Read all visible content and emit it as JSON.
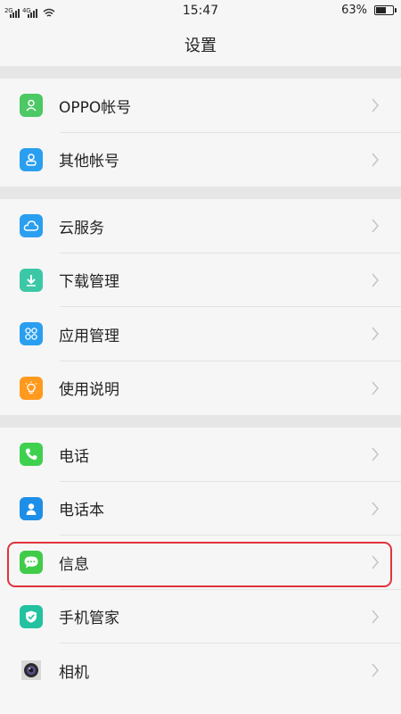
{
  "status_bar": {
    "sim1_network": "2G",
    "sim2_network": "4G",
    "time": "15:47",
    "battery_percent": "63%",
    "battery_level": 0.63
  },
  "header": {
    "title": "设置"
  },
  "sections": [
    {
      "items": [
        {
          "label": "OPPO帐号",
          "icon": "account-icon",
          "color": "#4cc864"
        },
        {
          "label": "其他帐号",
          "icon": "user-icon",
          "color": "#2a9ff0"
        }
      ]
    },
    {
      "items": [
        {
          "label": "云服务",
          "icon": "cloud-icon",
          "color": "#2a9ff0"
        },
        {
          "label": "下载管理",
          "icon": "download-icon",
          "color": "#3cc8a6"
        },
        {
          "label": "应用管理",
          "icon": "apps-icon",
          "color": "#2a9ff0"
        },
        {
          "label": "使用说明",
          "icon": "bulb-icon",
          "color": "#ff9a1f"
        }
      ]
    },
    {
      "items": [
        {
          "label": "电话",
          "icon": "phone-icon",
          "color": "#40d050"
        },
        {
          "label": "电话本",
          "icon": "contacts-icon",
          "color": "#1e8fe8"
        },
        {
          "label": "信息",
          "icon": "message-icon",
          "color": "#40cc48",
          "highlighted": true
        },
        {
          "label": "手机管家",
          "icon": "shield-icon",
          "color": "#22c2a0"
        },
        {
          "label": "相机",
          "icon": "camera-icon",
          "color": "#8a8a8a"
        }
      ]
    }
  ]
}
